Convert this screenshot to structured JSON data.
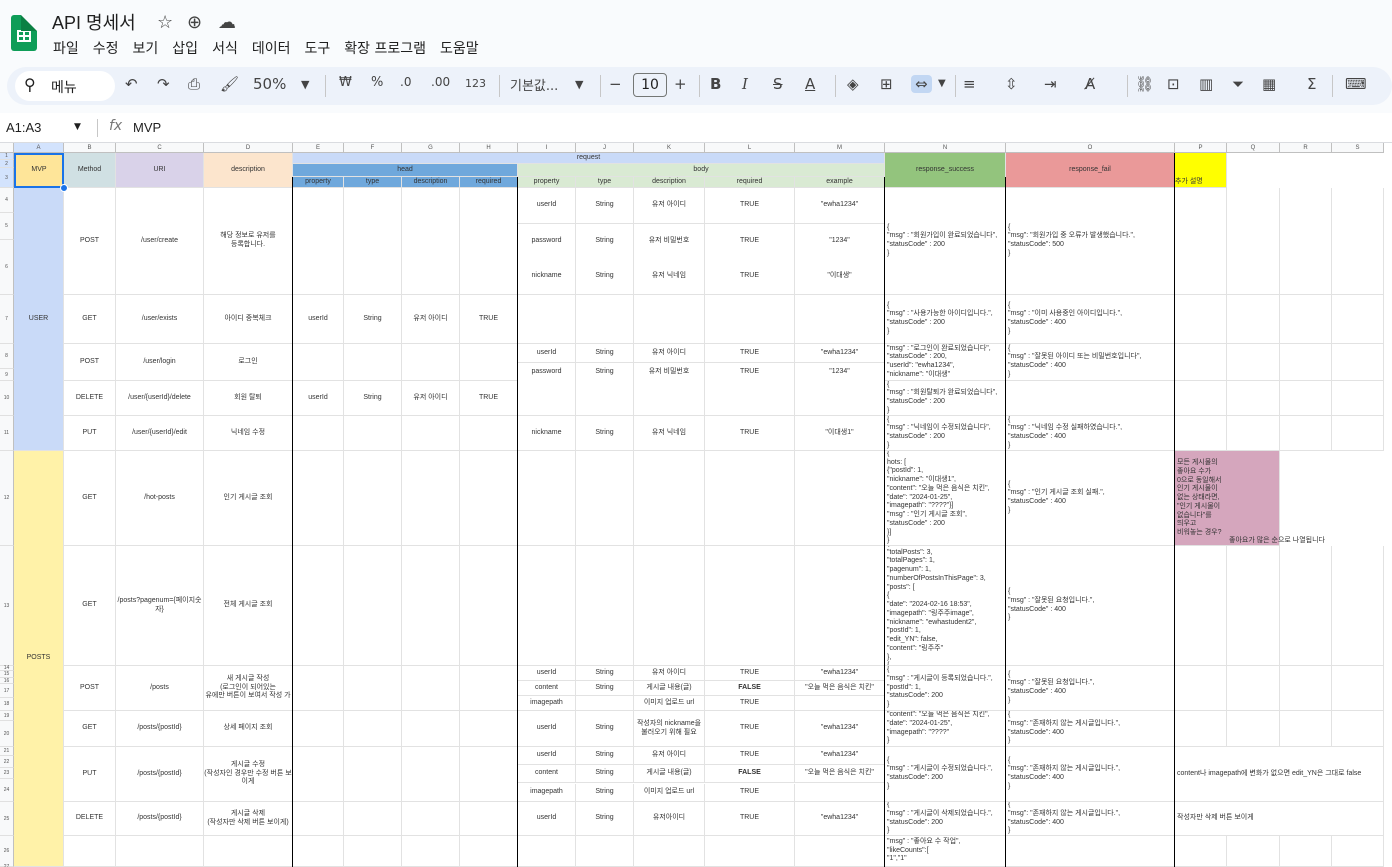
{
  "app": {
    "title": "API 명세서",
    "menus": [
      "파일",
      "수정",
      "보기",
      "삽입",
      "서식",
      "데이터",
      "도구",
      "확장 프로그램",
      "도움말"
    ]
  },
  "toolbar": {
    "search": "메뉴",
    "zoom": "50%",
    "currency": "₩",
    "percent": "%",
    "dec_dec": ".0",
    "dec_inc": ".00",
    "numfmt": "123",
    "font": "기본값...",
    "font_size": "10",
    "minus": "−",
    "plus": "+"
  },
  "formula": {
    "namebox": "A1:A3",
    "fx": "fx",
    "value": "MVP"
  },
  "cols": [
    "A",
    "B",
    "C",
    "D",
    "E",
    "F",
    "G",
    "H",
    "I",
    "J",
    "K",
    "L",
    "M",
    "N",
    "O",
    "P",
    "Q",
    "R",
    "S"
  ],
  "rows": [
    "1",
    "2",
    "3",
    "4",
    "5",
    "6",
    "7",
    "8",
    "9",
    "10",
    "11",
    "12",
    "13",
    "14",
    "15",
    "16",
    "17",
    "18",
    "19",
    "20",
    "21",
    "22",
    "23",
    "24",
    "25",
    "26",
    "27"
  ],
  "colors": {
    "mvp": "#fee599",
    "method": "#d0e0e3",
    "uri": "#d9d2e9",
    "desc": "#fce5cd",
    "request": "#c9daf8",
    "head": "#6fa8dc",
    "body": "#d9ead3",
    "success": "#93c47d",
    "fail": "#ea9999",
    "note": "#ffff00",
    "user": "#c9daf8",
    "posts": "#fff2a8",
    "comment": "#d5a6bd"
  },
  "header": {
    "mvp": "MVP",
    "method": "Method",
    "uri": "URI",
    "description": "description",
    "request": "request",
    "head": "head",
    "body": "body",
    "response_success": "response_success",
    "response_fail": "response_fail",
    "note": "추가 설명",
    "h_property": "property",
    "h_type": "type",
    "h_description": "description",
    "h_required": "required",
    "b_property": "property",
    "b_type": "type",
    "b_description": "description",
    "b_required": "required",
    "b_example": "example"
  },
  "groups": {
    "user": "USER",
    "posts": "POSTS"
  },
  "rows_data": {
    "r1": {
      "method": "POST",
      "uri": "/user/create",
      "desc": "해당 정보로 유저를\n등록합니다.",
      "success": "{\n\"msg\" : \"회원가입이 완료되었습니다\",\n\"statusCode\" : 200\n}",
      "fail": "{\n\"msg\": \"회원가입 중 오류가 발생했습니다.\",\n\"statusCode\": 500\n}",
      "b": [
        [
          "userId",
          "String",
          "유저 아이디",
          "TRUE",
          "\"ewha1234\""
        ],
        [
          "password",
          "String",
          "유저 비밀번호",
          "TRUE",
          "\"1234\""
        ],
        [
          "nickname",
          "String",
          "유저 닉네임",
          "TRUE",
          "\"이대생\""
        ]
      ]
    },
    "r2": {
      "method": "GET",
      "uri": "/user/exists",
      "desc": "아이디 중복체크",
      "h": [
        "userId",
        "String",
        "유저 아이디",
        "TRUE"
      ],
      "success": "{\n\"msg\" : \"사용가능한 아이디입니다.\",\n\"statusCode\" : 200\n}",
      "fail": "{\n\"msg\" : \"이미 사용중인 아이디입니다.\",\n\"statusCode\" : 400\n}"
    },
    "r3": {
      "method": "POST",
      "uri": "/user/login",
      "desc": "로그인",
      "b": [
        [
          "userId",
          "String",
          "유저 아이디",
          "TRUE",
          "\"ewha1234\""
        ],
        [
          "password",
          "String",
          "유저 비밀번호",
          "TRUE",
          "\"1234\""
        ]
      ],
      "success": "\"msg\" : \"로그인이 완료되었습니다\",\n\"statusCode\" : 200,\n\"userId\": \"ewha1234\",\n\"nickname\": \"이대생\"",
      "fail": "{\n\"msg\" : \"잘못된 아이디 또는 비밀번호입니다\",\n\"statusCode\" : 400\n}"
    },
    "r4": {
      "method": "DELETE",
      "uri": "/user/{userId}/delete",
      "desc": "회원 탈퇴",
      "h": [
        "userId",
        "String",
        "유저 아이디",
        "TRUE"
      ],
      "success": "{\n\"msg\" : \"회원탈퇴가 완료되었습니다\",\n\"statusCode\" : 200\n}",
      "fail": ""
    },
    "r5": {
      "method": "PUT",
      "uri": "/user/{userId}/edit",
      "desc": "닉네임 수정",
      "b": [
        [
          "nickname",
          "String",
          "유저 닉네임",
          "TRUE",
          "\"이대생1\""
        ]
      ],
      "success": "{\n\"msg\" : \"닉네임이 수정되었습니다\",\n\"statusCode\" : 200\n}",
      "fail": "{\n\"msg\" : \"닉네임 수정 실패하였습니다.\",\n\"statusCode\" : 400\n}"
    },
    "r6": {
      "method": "GET",
      "uri": "/hot-posts",
      "desc": "인기 게시글 조회",
      "success": "{\nhots: [\n{\"postId\": 1,\n\"nickname\": \"이대생1\",\n\"content\": \"오늘 먹은 음식은 치킨\",\n\"date\": \"2024-01-25\",\n\"imagepath\": \"????\"}]\n\"msg\" : \"인기 게시글 조회\",\n\"statusCode\" : 200\n}]\n}",
      "fail": "{\n\"msg\" : \"인기 게시글 조회 실패.\",\n\"statusCode\" : 400\n}",
      "note": "모든 게시물의\n좋아요 수가\n0으로 동일해서\n인기 게시물이\n없는 상태라면,\n\"인기 게시물이\n없습니다\"를\n띄우고\n비워놓는 경우?",
      "note2": "좋아요가 많은 순으로 나열됩니다"
    },
    "r7": {
      "method": "GET",
      "uri": "/posts?pagenum={페이지숫자}",
      "desc": "전체 게시글 조회",
      "success": "{\n   \"totalPosts\": 3,\n   \"totalPages\": 1,\n   \"pagenum\": 1,\n   \"numberOfPostsInThisPage\": 3,\n   \"posts\": [\n      {\n         \"date\": \"2024-02-16 18:53\",\n         \"imagepath\": \"링주주image\",\n         \"nickname\": \"ewhastudent2\",\n         \"postId\": 1,\n         \"edit_YN\": false,\n         \"content\": \"링주주\"\n      },\n   {",
      "fail": "{\n\"msg\" : \"잘못된 요청입니다.\",\n\"statusCode\" : 400\n}"
    },
    "r8": {
      "method": "POST",
      "uri": "/posts",
      "desc": "새 게시글 작성\n(로그인이 되어있는\n유에만 버튼이 보여서 작성 가",
      "b": [
        [
          "userId",
          "String",
          "유저 아이디",
          "TRUE",
          "\"ewha1234\""
        ],
        [
          "content",
          "String",
          "게시글 내용(글)",
          "FALSE",
          "\"오늘 먹은 음식은 치킨\""
        ],
        [
          "imagepath",
          "",
          "이미지 업로드 url",
          "TRUE",
          ""
        ]
      ],
      "success": "{\n\"msg\" : \"게시글이 등록되었습니다.\",\n\"postId\": 1,\n\"statusCode\": 200\n}",
      "fail": "{\n\"msg\" : \"잘못된 요청입니다.\",\n\"statusCode\" : 400\n}"
    },
    "r9": {
      "method": "GET",
      "uri": "/posts/{postId}",
      "desc": "상세 페이지 조회",
      "b": [
        [
          "userId",
          "String",
          "작성자의 nickname을\n불러오기 위해 필요",
          "TRUE",
          "\"ewha1234\""
        ]
      ],
      "success": "\"content\": \"오늘 먹은 음식은 치킨\",\n\"date\": \"2024-01-25\",\n\"imagepath\": \"????\"\n}",
      "fail": "{\n\"msg\": \"존재하지 않는 게시글입니다.\",\n\"statusCode\": 400\n}"
    },
    "r10": {
      "method": "PUT",
      "uri": "/posts/{postId}",
      "desc": "게시글 수정\n(작성자인 경우만 수정 버튼 보이게",
      "b": [
        [
          "userId",
          "String",
          "유저 아이디",
          "TRUE",
          "\"ewha1234\""
        ],
        [
          "content",
          "String",
          "게시글 내용(글)",
          "FALSE",
          "\"오늘 먹은 음식은 치킨\""
        ],
        [
          "imagepath",
          "String",
          "이미지 업로드 url",
          "TRUE",
          ""
        ]
      ],
      "success": "{\n\"msg\" : \"게시글이 수정되었습니다.\",\n\"statusCode\": 200\n}",
      "fail": "{\n\"msg\": \"존재하지 않는 게시글입니다.\",\n\"statusCode\": 400\n}",
      "note": "content나 imagepath에 변화가 없으면 edit_YN은 그대로 false"
    },
    "r11": {
      "method": "DELETE",
      "uri": "/posts/{postId}",
      "desc": "게시글 삭제\n(작성자만 삭제 버튼 보이게)",
      "b": [
        [
          "userId",
          "String",
          "유저아이디",
          "TRUE",
          "\"ewha1234\""
        ]
      ],
      "success": "{\n\"msg\" : \"게시글이 삭제되었습니다.\",\n\"statusCode\": 200\n}",
      "fail": "{\n\"msg\": \"존재하지 않는 게시글입니다.\",\n\"statusCode\": 400\n}",
      "note": "작성자만 삭제 버튼 보이게"
    },
    "r12": {
      "success": "\"msg\" : \"좋아요 수 작업\",\n\"likeCounts\":[\n\"1\",\"1\""
    }
  }
}
